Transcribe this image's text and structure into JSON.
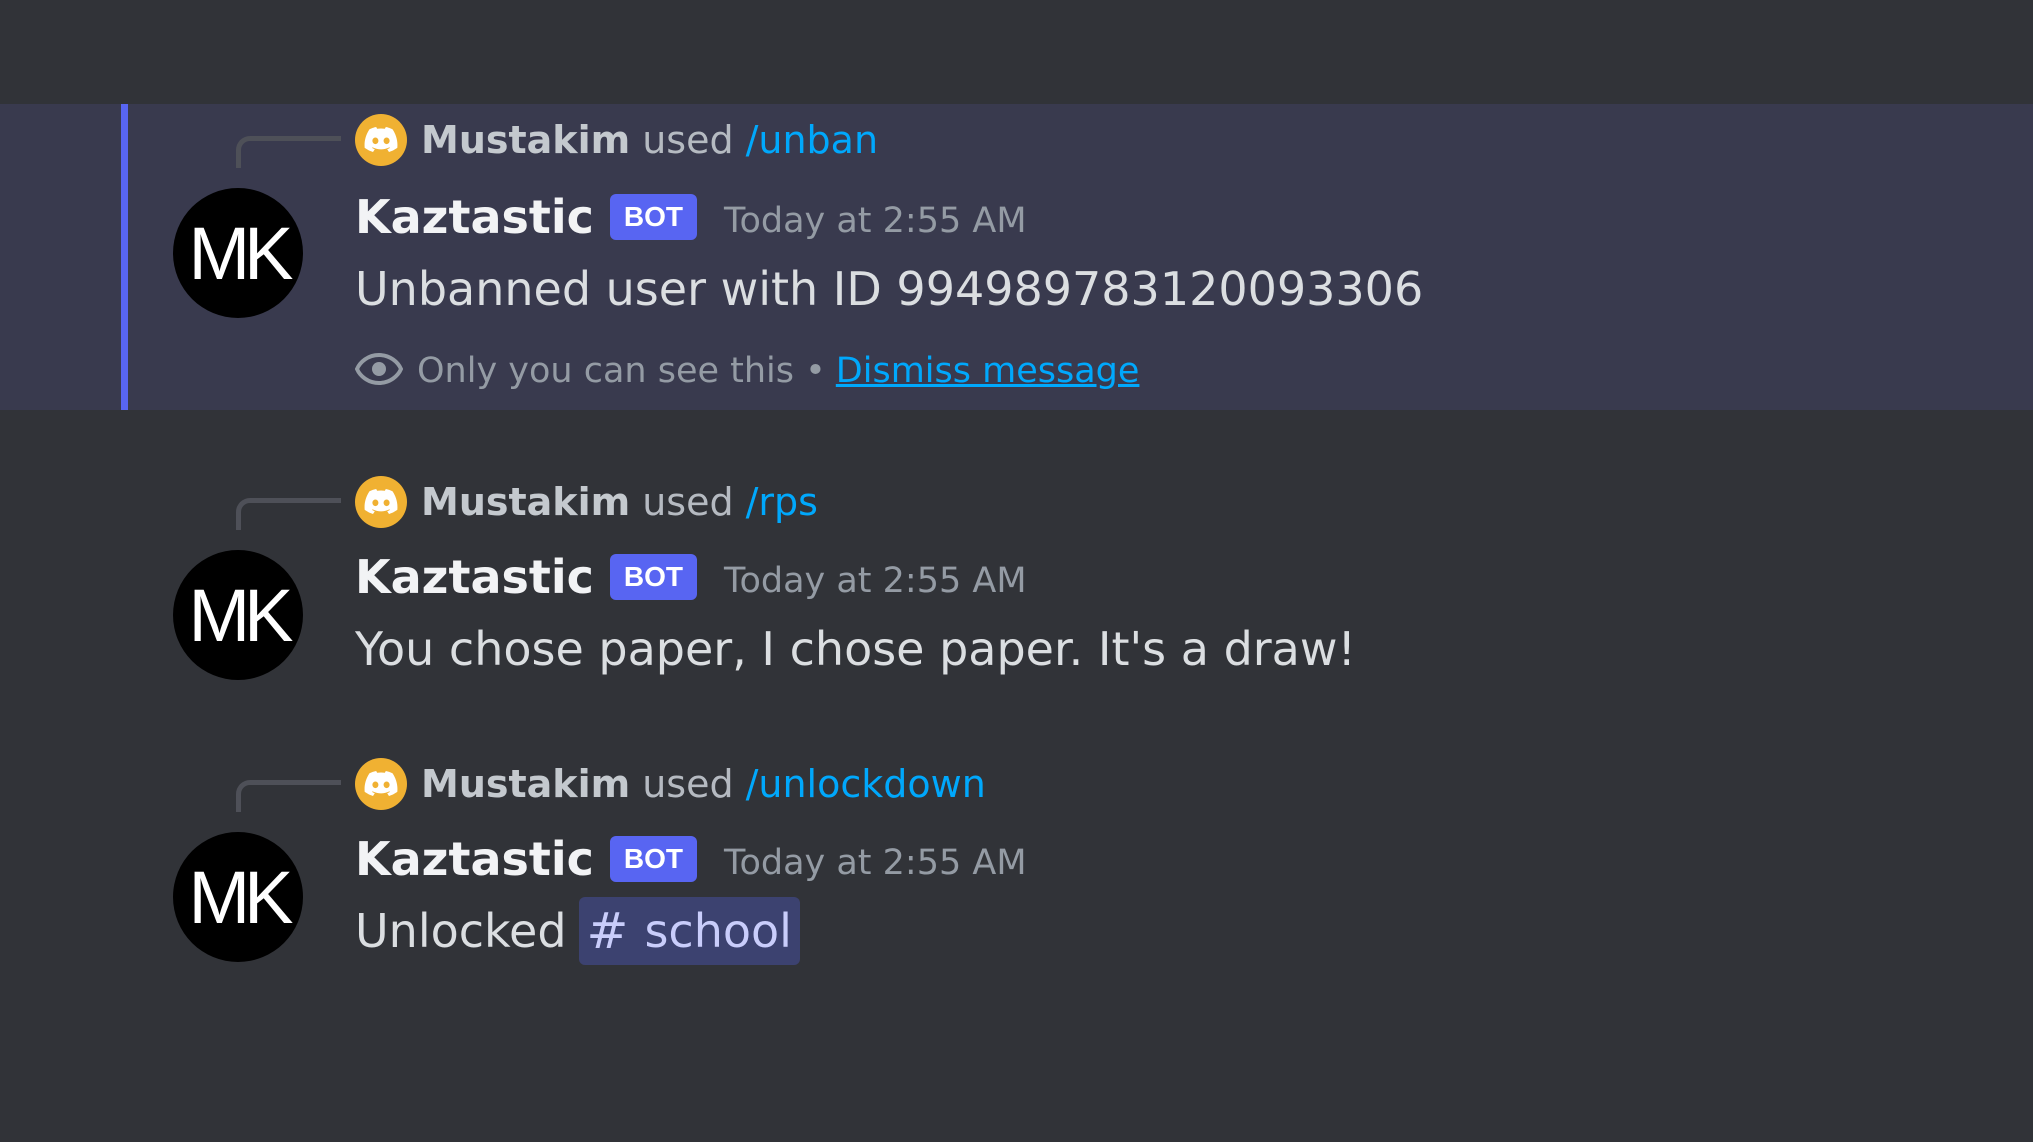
{
  "messages": [
    {
      "reply": {
        "user": "Mustakim",
        "used": "used",
        "command": "/unban"
      },
      "author": "Kaztastic",
      "bot_tag": "BOT",
      "timestamp": "Today at 2:55 AM",
      "content": "Unbanned user with ID 994989783120093306",
      "avatar_text": "MK",
      "ephemeral": {
        "text": "Only you can see this •",
        "link": "Dismiss message"
      }
    },
    {
      "reply": {
        "user": "Mustakim",
        "used": "used",
        "command": "/rps"
      },
      "author": "Kaztastic",
      "bot_tag": "BOT",
      "timestamp": "Today at 2:55 AM",
      "content": "You chose paper, I chose paper. It's a draw!",
      "avatar_text": "MK"
    },
    {
      "reply": {
        "user": "Mustakim",
        "used": "used",
        "command": "/unlockdown"
      },
      "author": "Kaztastic",
      "bot_tag": "BOT",
      "timestamp": "Today at 2:55 AM",
      "content": "Unlocked",
      "avatar_text": "MK",
      "channel_mention": {
        "hash": "#",
        "name": "school"
      }
    }
  ],
  "icons": {
    "reply_avatar": "discord-logo-icon",
    "ephemeral": "eye-icon"
  },
  "colors": {
    "background": "#313338",
    "highlight_background": "#393a4e",
    "highlight_bar": "#5865f2",
    "bot_tag": "#5865f2",
    "command": "#00a8fc",
    "link": "#00a8fc",
    "reply_avatar": "#f0b132",
    "channel_mention_bg": "#3c4270"
  }
}
